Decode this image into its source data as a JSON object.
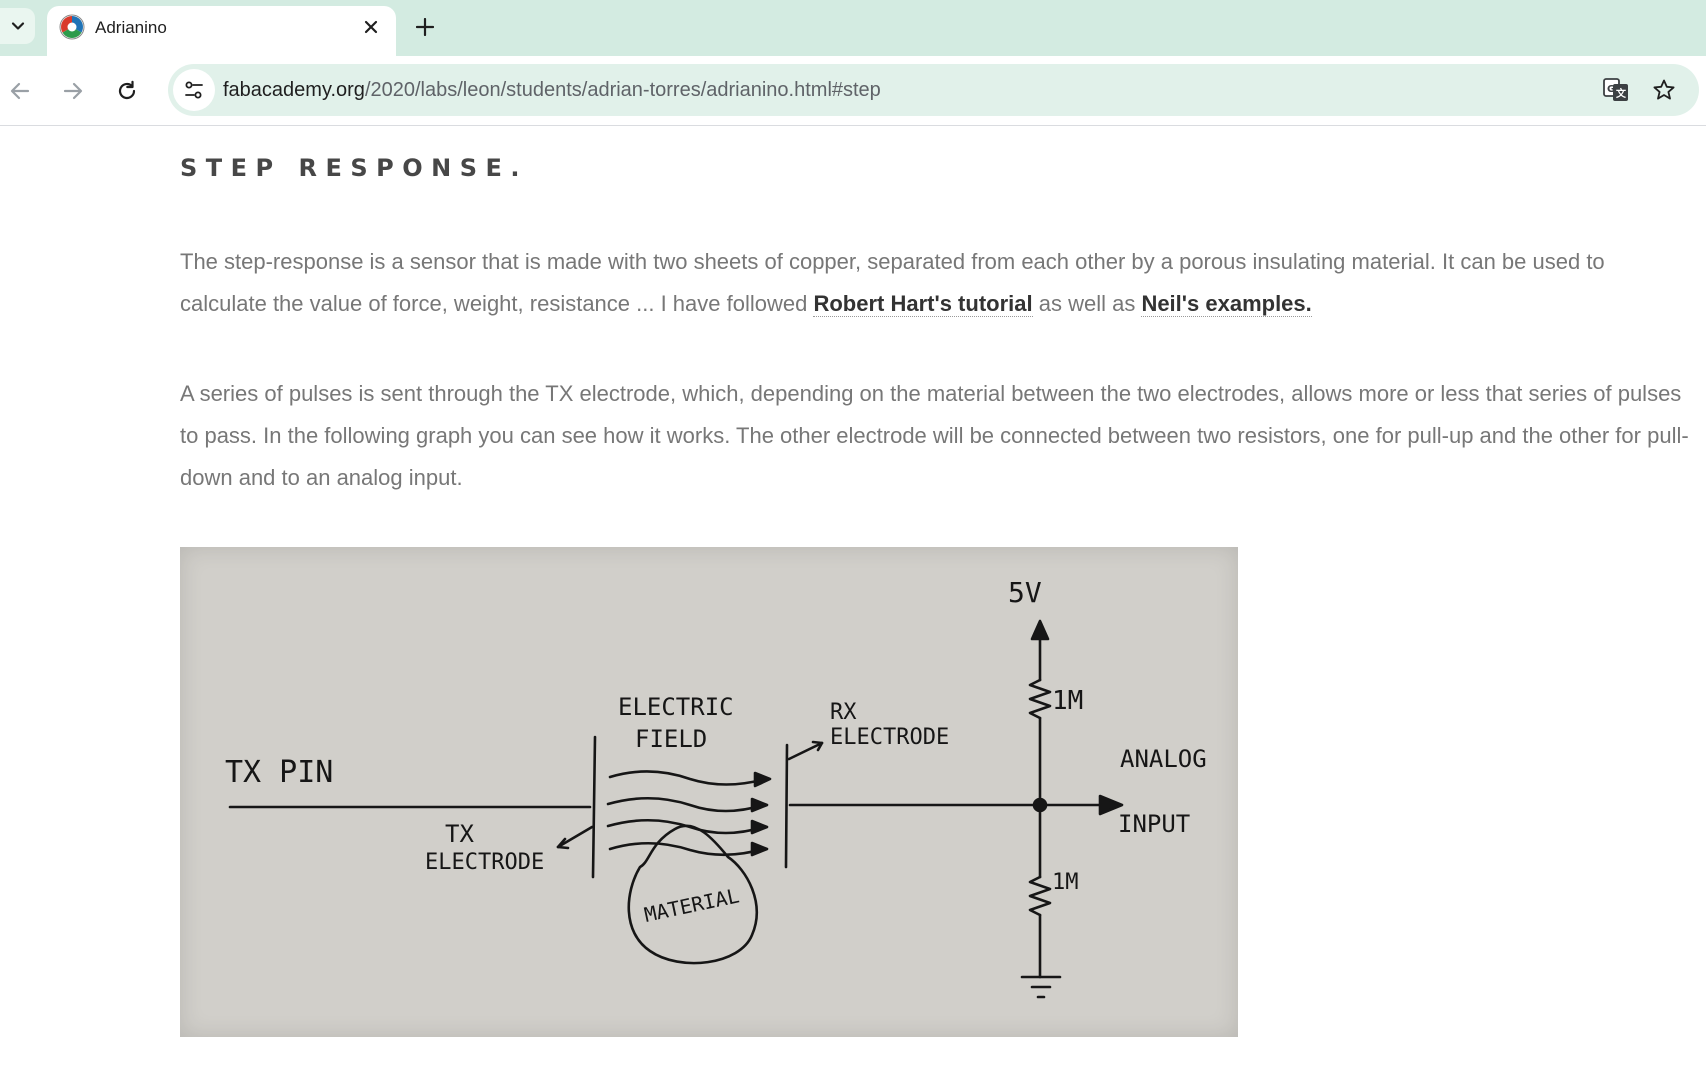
{
  "browser": {
    "tab": {
      "title": "Adrianino"
    },
    "address_bar": {
      "host": "fabacademy.org",
      "path": "/2020/labs/leon/students/adrian-torres/adrianino.html#step"
    },
    "colors": {
      "frame": "#d3ebe1",
      "omnibox": "#e1f1ea"
    }
  },
  "page": {
    "section_title": "STEP RESPONSE.",
    "paragraph1": {
      "text_before": "The step-response is a sensor that is made with two sheets of copper, separated from each other by a porous insulating material. It can be used to calculate the value of force, weight, resistance ... I have followed ",
      "link1": "Robert Hart's tutorial",
      "text_middle": " as well as ",
      "link2": "Neil's examples."
    },
    "paragraph2": "A series of pulses is sent through the TX electrode, which, depending on the material between the two electrodes, allows more or less that series of pulses to pass. In the following graph you can see how it works. The other electrode will be connected between two resistors, one for pull-up and the other for pull-down and to an analog input.",
    "diagram": {
      "tx_pin": "TX PIN",
      "tx_electrode_1": "TX",
      "tx_electrode_2": "ELECTRODE",
      "electric_field_1": "ELECTRIC",
      "electric_field_2": "FIELD",
      "rx_electrode_1": "RX",
      "rx_electrode_2": "ELECTRODE",
      "material": "MATERIAL",
      "supply": "5V",
      "resistor_top": "1M",
      "resistor_bottom": "1M",
      "analog_1": "ANALOG",
      "analog_2": "INPUT"
    }
  }
}
